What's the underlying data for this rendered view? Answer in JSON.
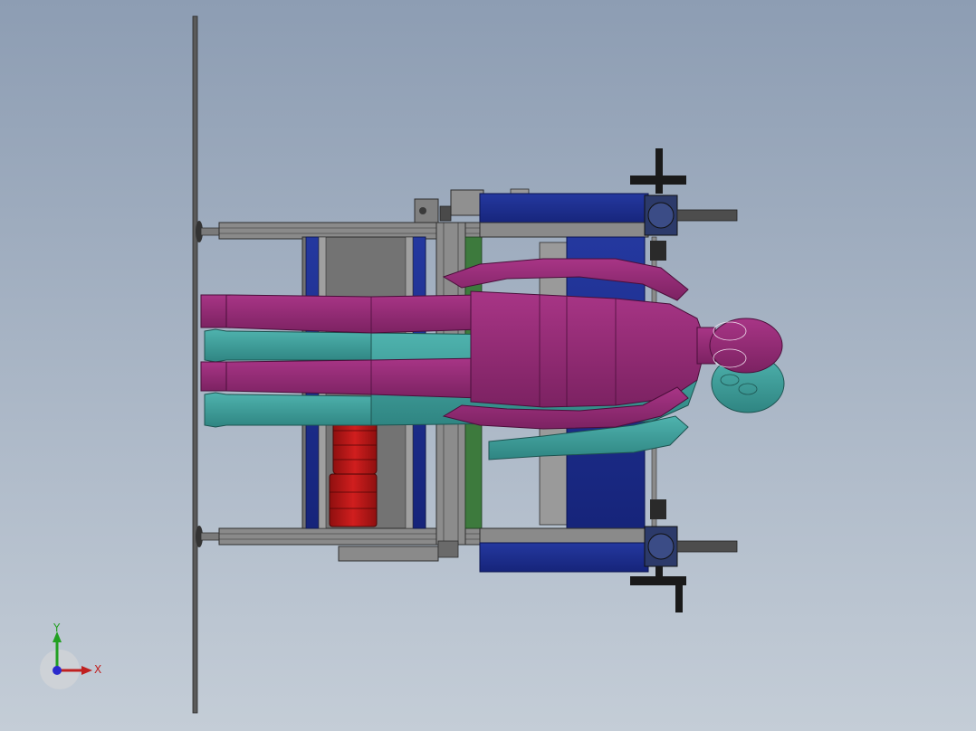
{
  "viewport": {
    "background_top": "#8d9db3",
    "background_bottom": "#c4cdd7"
  },
  "colors": {
    "frame_gray": "#6f6f6f",
    "frame_dark": "#3a3a3a",
    "blue_panel": "#1b2c8c",
    "motor_red": "#b51515",
    "mannequin_magenta": "#9b2c7a",
    "mannequin_teal": "#3d9e9b",
    "green_rail": "#3d7a3d"
  },
  "triad": {
    "y_label": "Y",
    "x_label": "X",
    "y_color": "#22a022",
    "x_color": "#c02020",
    "z_color": "#2a2acc"
  }
}
